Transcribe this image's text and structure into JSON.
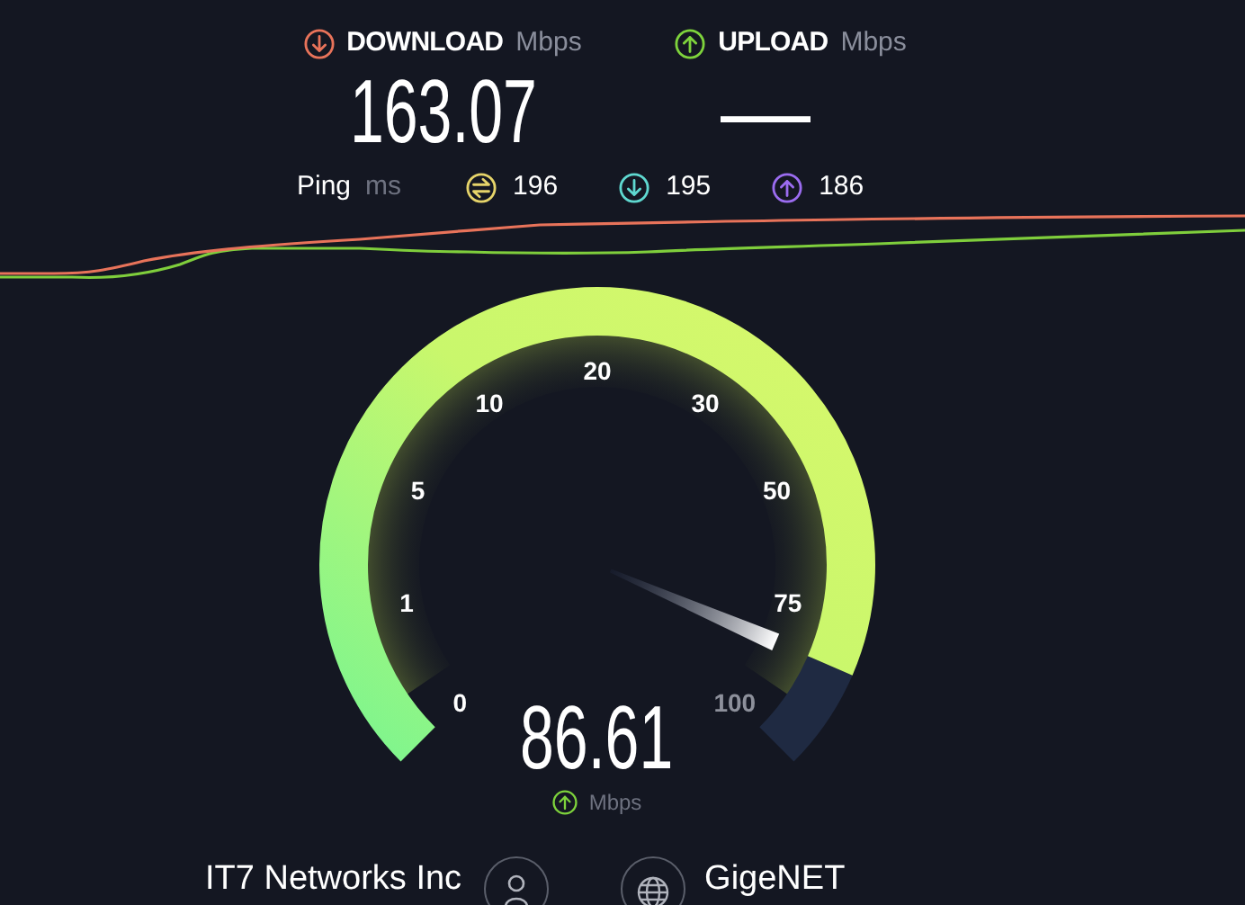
{
  "download": {
    "label": "DOWNLOAD",
    "unit": "Mbps",
    "value": "163.07"
  },
  "upload": {
    "label": "UPLOAD",
    "unit": "Mbps",
    "value": "—"
  },
  "ping": {
    "label": "Ping",
    "unit": "ms",
    "items": [
      {
        "kind": "jitter",
        "value": "196"
      },
      {
        "kind": "down",
        "value": "195"
      },
      {
        "kind": "up",
        "value": "186"
      }
    ]
  },
  "gauge": {
    "ticks": [
      "0",
      "1",
      "5",
      "10",
      "20",
      "30",
      "50",
      "75",
      "100"
    ],
    "reading": "86.61",
    "unit": "Mbps"
  },
  "servers": {
    "provider": "IT7 Networks Inc",
    "host": "GigeNET"
  }
}
